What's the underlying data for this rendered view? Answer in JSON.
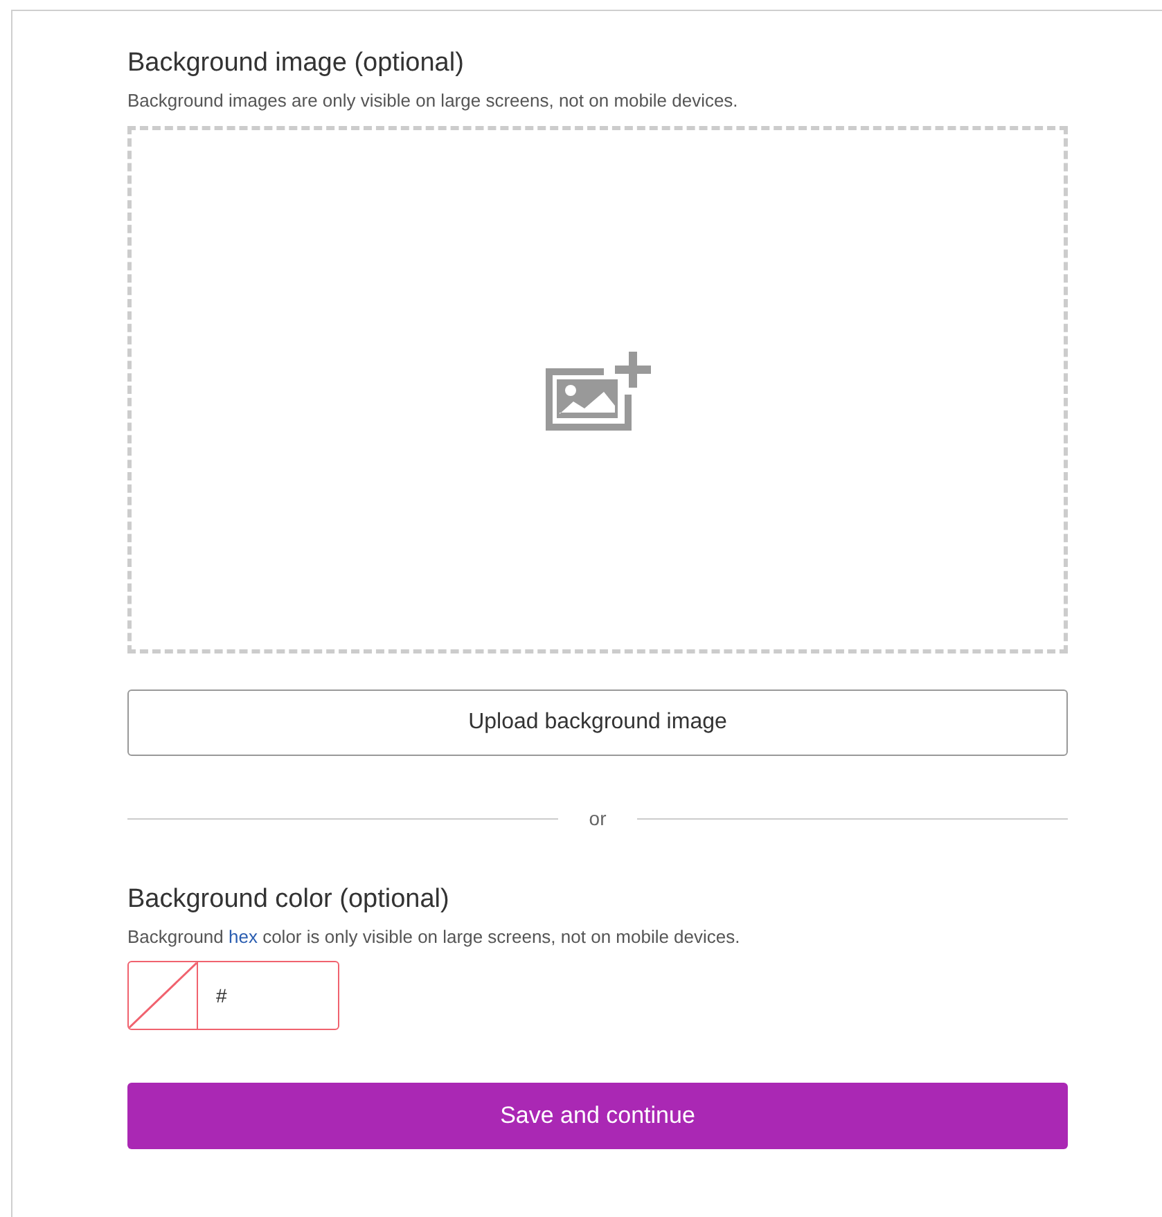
{
  "image_section": {
    "title": "Background image (optional)",
    "description": "Background images are only visible on large screens, not on mobile devices.",
    "upload_button": "Upload background image"
  },
  "divider": "or",
  "color_section": {
    "title": "Background color (optional)",
    "description_before": "Background ",
    "description_link": "hex",
    "description_after": " color is only visible on large screens, not on mobile devices.",
    "color_field": {
      "value": "#",
      "invalid": true
    }
  },
  "save_button": "Save and continue"
}
